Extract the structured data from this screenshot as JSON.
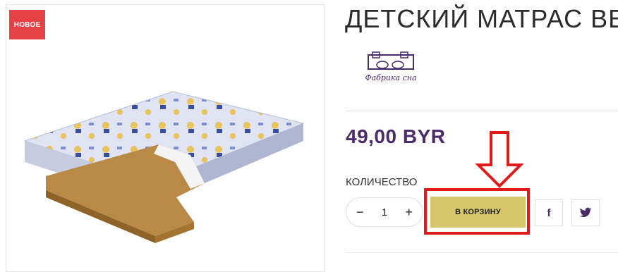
{
  "product": {
    "badge": "НОВОЕ",
    "title": "ДЕТСКИЙ МАТРАС ВЕ",
    "brand_logo_text": "Фабрика сна",
    "price": "49,00 BYR"
  },
  "quantity": {
    "label": "КОЛИЧЕСТВО",
    "decrease_symbol": "−",
    "value": "1",
    "increase_symbol": "+"
  },
  "actions": {
    "add_to_cart_label": "В КОРЗИНУ",
    "facebook_glyph": "f",
    "twitter_icon": "twitter-icon"
  },
  "annotation": {
    "highlight_color": "#e11b1b",
    "arrow_color": "#e11b1b"
  },
  "colors": {
    "badge_red": "#e64245",
    "price_purple": "#4b2a6a",
    "cart_gold": "#d6c66b"
  }
}
